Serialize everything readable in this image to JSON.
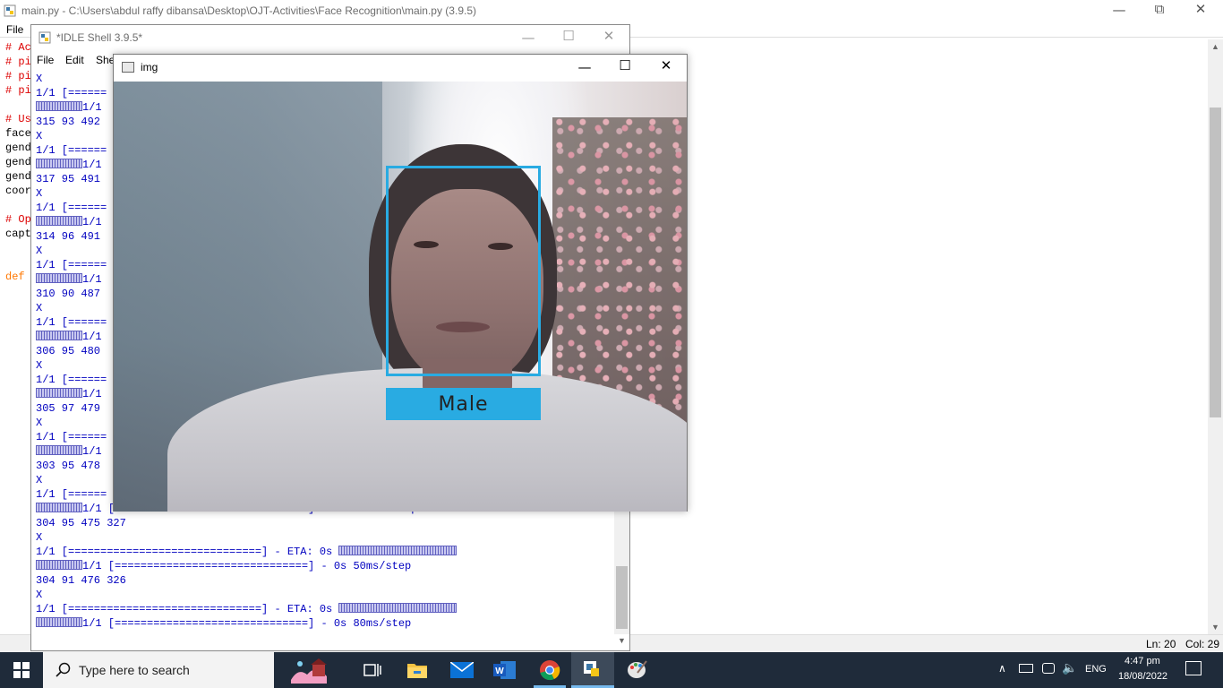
{
  "editor": {
    "title": "main.py - C:\\Users\\abdul raffy dibansa\\Desktop\\OJT-Activities\\Face Recognition\\main.py (3.9.5)",
    "menu": [
      "File"
    ],
    "lines": [
      {
        "text": "# Ac",
        "cls": "code-red"
      },
      {
        "text": "# pi",
        "cls": "code-red"
      },
      {
        "text": "# pi",
        "cls": "code-red"
      },
      {
        "text": "# pi",
        "cls": "code-red"
      },
      {
        "text": "",
        "cls": ""
      },
      {
        "text": "# Us",
        "cls": "code-red"
      },
      {
        "text": "face",
        "cls": ""
      },
      {
        "text": "gend",
        "cls": ""
      },
      {
        "text": "gend",
        "cls": ""
      },
      {
        "text": "gend",
        "cls": ""
      },
      {
        "text": "coor",
        "cls": ""
      },
      {
        "text": "",
        "cls": ""
      },
      {
        "text": "# Op",
        "cls": "code-red"
      },
      {
        "text": "capt",
        "cls": ""
      },
      {
        "text": "",
        "cls": ""
      },
      {
        "text": "",
        "cls": ""
      },
      {
        "text": "def",
        "cls": "code-orange"
      }
    ],
    "status": {
      "line": "Ln: 20",
      "col": "Col: 29"
    }
  },
  "shell": {
    "title": "*IDLE Shell 3.9.5*",
    "menu": [
      "File",
      "Edit",
      "She"
    ],
    "lines": [
      {
        "pre": "X"
      },
      {
        "pre": "1/1 [======"
      },
      {
        "sq": true,
        "pre": "1/1"
      },
      {
        "pre": "315 93 492"
      },
      {
        "pre": "X"
      },
      {
        "pre": "1/1 [======"
      },
      {
        "sq": true,
        "pre": "1/1"
      },
      {
        "pre": "317 95 491"
      },
      {
        "pre": "X"
      },
      {
        "pre": "1/1 [======"
      },
      {
        "sq": true,
        "pre": "1/1"
      },
      {
        "pre": "314 96 491"
      },
      {
        "pre": "X"
      },
      {
        "pre": "1/1 [======"
      },
      {
        "sq": true,
        "pre": "1/1"
      },
      {
        "pre": "310 90 487"
      },
      {
        "pre": "X"
      },
      {
        "pre": "1/1 [======"
      },
      {
        "sq": true,
        "pre": "1/1"
      },
      {
        "pre": "306 95 480"
      },
      {
        "pre": "X"
      },
      {
        "pre": "1/1 [======"
      },
      {
        "sq": true,
        "pre": "1/1"
      },
      {
        "pre": "305 97 479"
      },
      {
        "pre": "X"
      },
      {
        "pre": "1/1 [======"
      },
      {
        "sq": true,
        "pre": "1/1"
      },
      {
        "pre": "303 95 478"
      },
      {
        "pre": "X"
      },
      {
        "pre": "1/1 [======"
      },
      {
        "sq": true,
        "pre": "1/1 [                              ]  - 0s 50ms/step"
      },
      {
        "pre": "304 95 475 327"
      },
      {
        "pre": "X"
      },
      {
        "pre": "1/1 [==============================] - ETA: 0s ",
        "sqlong": true
      },
      {
        "sq": true,
        "pre": "1/1 [==============================] - 0s 50ms/step"
      },
      {
        "pre": "304 91 476 326"
      },
      {
        "pre": "X"
      },
      {
        "pre": "1/1 [==============================] - ETA: 0s ",
        "sqlong": true
      },
      {
        "sq": true,
        "pre": "1/1 [==============================] - 0s 80ms/step"
      }
    ]
  },
  "img_window": {
    "title": "img",
    "label": "Male",
    "box_color": "#29abe2"
  },
  "taskbar": {
    "search_placeholder": "Type here to search",
    "lang": "ENG",
    "time": "4:47 pm",
    "date": "18/08/2022",
    "icons": [
      "weather-widget-icon",
      "task-view-icon",
      "file-explorer-icon",
      "mail-icon",
      "word-icon",
      "chrome-icon",
      "python-idle-icon",
      "paint-icon"
    ]
  }
}
